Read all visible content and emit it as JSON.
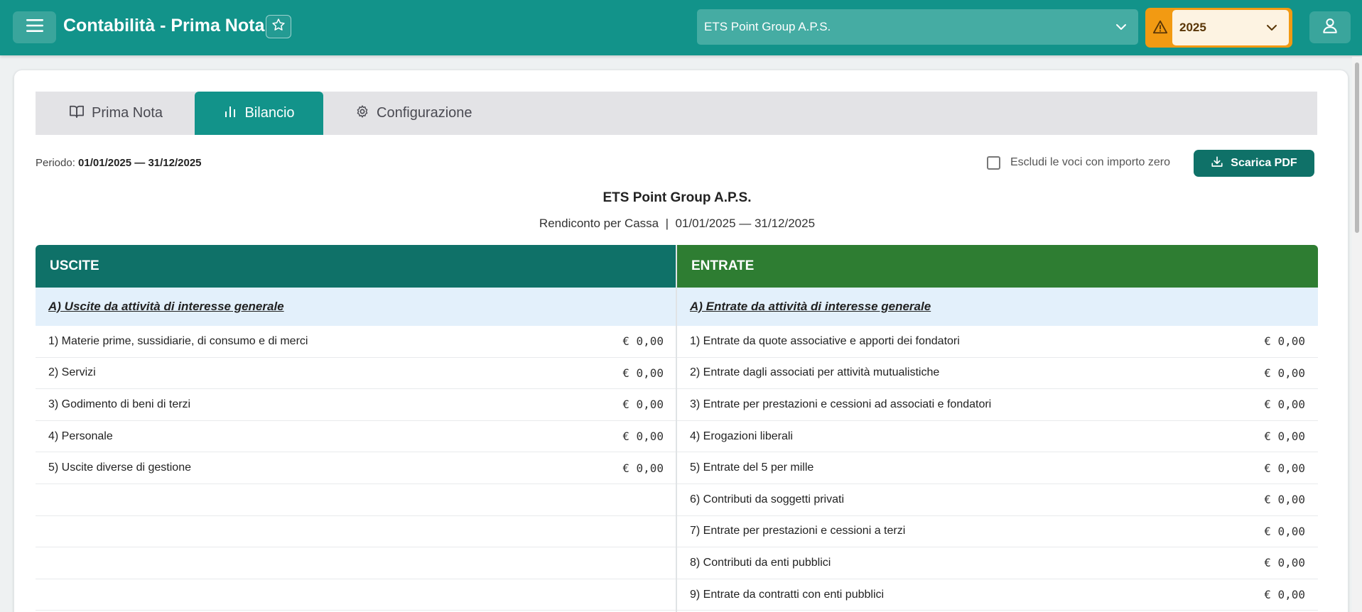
{
  "header": {
    "title": "Contabilità - Prima Nota",
    "organization": "ETS Point Group A.P.S.",
    "year": "2025"
  },
  "tabs": [
    {
      "label": "Prima Nota",
      "icon": "book-icon",
      "active": false
    },
    {
      "label": "Bilancio",
      "icon": "bar-chart-icon",
      "active": true
    },
    {
      "label": "Configurazione",
      "icon": "gear-icon",
      "active": false
    }
  ],
  "toolbar": {
    "period_label": "Periodo:",
    "period_value": "01/01/2025 — 31/12/2025",
    "exclude_zero_label": "Escludi le voci con importo zero",
    "pdf_button_label": "Scarica PDF"
  },
  "report": {
    "title": "ETS Point Group A.P.S.",
    "subtitle": "Rendiconto per Cassa  |  01/01/2025 — 31/12/2025"
  },
  "uscite": {
    "header": "USCITE",
    "section": "A) Uscite da attività di interesse generale",
    "rows": [
      {
        "label": "1) Materie prime, sussidiarie, di consumo e di merci",
        "amount": "€ 0,00"
      },
      {
        "label": "2) Servizi",
        "amount": "€ 0,00"
      },
      {
        "label": "3) Godimento di beni di terzi",
        "amount": "€ 0,00"
      },
      {
        "label": "4) Personale",
        "amount": "€ 0,00"
      },
      {
        "label": "5) Uscite diverse di gestione",
        "amount": "€ 0,00"
      },
      {
        "label": "",
        "amount": ""
      },
      {
        "label": "",
        "amount": ""
      },
      {
        "label": "",
        "amount": ""
      },
      {
        "label": "",
        "amount": ""
      }
    ]
  },
  "entrate": {
    "header": "ENTRATE",
    "section": "A) Entrate da attività di interesse generale",
    "rows": [
      {
        "label": "1) Entrate da quote associative e apporti dei fondatori",
        "amount": "€ 0,00"
      },
      {
        "label": "2) Entrate dagli associati per attività mutualistiche",
        "amount": "€ 0,00"
      },
      {
        "label": "3) Entrate per prestazioni e cessioni ad associati e fondatori",
        "amount": "€ 0,00"
      },
      {
        "label": "4) Erogazioni liberali",
        "amount": "€ 0,00"
      },
      {
        "label": "5) Entrate del 5 per mille",
        "amount": "€ 0,00"
      },
      {
        "label": "6) Contributi da soggetti privati",
        "amount": "€ 0,00"
      },
      {
        "label": "7) Entrate per prestazioni e cessioni a terzi",
        "amount": "€ 0,00"
      },
      {
        "label": "8) Contributi da enti pubblici",
        "amount": "€ 0,00"
      },
      {
        "label": "9) Entrate da contratti con enti pubblici",
        "amount": "€ 0,00"
      }
    ]
  },
  "colors": {
    "topbar": "#12938a",
    "accent_dark": "#0f7168",
    "entrate_header": "#2e7d32",
    "year_warning": "#f29a12",
    "section_bg": "#e3f0fb"
  }
}
